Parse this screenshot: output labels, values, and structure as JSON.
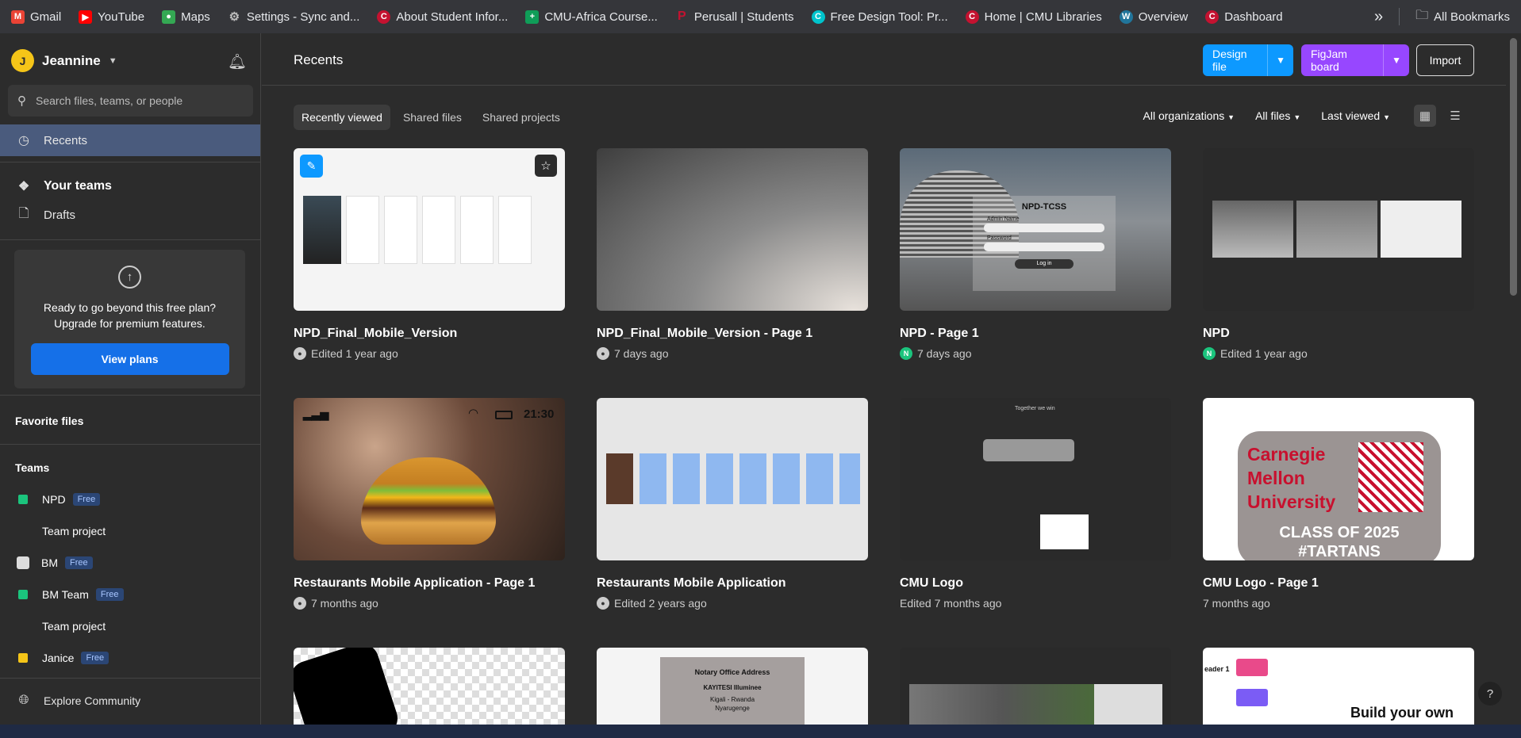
{
  "bookmarks": {
    "items": [
      {
        "label": "Gmail",
        "icon": "gmail-icon",
        "color": "#ea4335"
      },
      {
        "label": "YouTube",
        "icon": "youtube-icon",
        "color": "#ff0000"
      },
      {
        "label": "Maps",
        "icon": "maps-icon",
        "color": "#34a853"
      },
      {
        "label": "Settings - Sync and...",
        "icon": "settings-gear-icon",
        "color": "#9aa0a6"
      },
      {
        "label": "About Student Infor...",
        "icon": "cmu-icon",
        "color": "#c41230"
      },
      {
        "label": "CMU-Africa Course...",
        "icon": "sheets-icon",
        "color": "#0f9d58"
      },
      {
        "label": "Perusall | Students",
        "icon": "perusall-icon",
        "color": "#c41230"
      },
      {
        "label": "Free Design Tool: Pr...",
        "icon": "canva-icon",
        "color": "#00c4cc"
      },
      {
        "label": "Home | CMU Libraries",
        "icon": "cmu-icon",
        "color": "#c41230"
      },
      {
        "label": "Overview",
        "icon": "wordpress-icon",
        "color": "#21759b"
      },
      {
        "label": "Dashboard",
        "icon": "cmu-icon",
        "color": "#c41230"
      }
    ],
    "overflow_glyph": "»",
    "all_bookmarks": "All Bookmarks"
  },
  "sidebar": {
    "user": {
      "initial": "J",
      "name": "Jeannine"
    },
    "search_placeholder": "Search files, teams, or people",
    "nav": {
      "recents": "Recents",
      "your_teams": "Your teams",
      "drafts": "Drafts"
    },
    "upgrade": {
      "line1": "Ready to go beyond this free plan?",
      "line2": "Upgrade for premium features.",
      "button": "View plans"
    },
    "favorite_files": "Favorite files",
    "teams_title": "Teams",
    "teams": [
      {
        "name": "NPD",
        "badge": "Free",
        "color": "#1bc47d"
      },
      {
        "name": "Team project",
        "badge": "",
        "color": ""
      },
      {
        "name": "BM",
        "badge": "Free",
        "color": "avatar"
      },
      {
        "name": "BM Team",
        "badge": "Free",
        "color": "#1bc47d"
      },
      {
        "name": "Team project",
        "badge": "",
        "color": ""
      },
      {
        "name": "Janice",
        "badge": "Free",
        "color": "#f5c518"
      }
    ],
    "explore": "Explore Community"
  },
  "header": {
    "title": "Recents",
    "design_file": "Design file",
    "figjam_board": "FigJam board",
    "import": "Import"
  },
  "tabs": [
    "Recently viewed",
    "Shared files",
    "Shared projects"
  ],
  "filters": {
    "org": "All organizations",
    "files": "All files",
    "sort": "Last viewed"
  },
  "files": [
    {
      "name": "NPD_Final_Mobile_Version",
      "meta": "Edited 1 year ago",
      "avatar": "globe"
    },
    {
      "name": "NPD_Final_Mobile_Version - Page 1",
      "meta": "7 days ago",
      "avatar": "globe"
    },
    {
      "name": "NPD - Page 1",
      "meta": "7 days ago",
      "avatar": "N"
    },
    {
      "name": "NPD",
      "meta": "Edited 1 year ago",
      "avatar": "N"
    },
    {
      "name": "Restaurants Mobile Application - Page 1",
      "meta": "7 months ago",
      "avatar": "globe"
    },
    {
      "name": "Restaurants Mobile Application",
      "meta": "Edited 2 years ago",
      "avatar": "globe"
    },
    {
      "name": "CMU Logo",
      "meta": "Edited 7 months ago",
      "avatar": ""
    },
    {
      "name": "CMU Logo - Page 1",
      "meta": "7 months ago",
      "avatar": ""
    }
  ],
  "thumb_text": {
    "npd_tcss": "NPD-TCSS",
    "admin_name": "Admin Name",
    "password": "Password",
    "login": "Log in",
    "status_time": "21:30",
    "together": "Together we win",
    "cmu_words": [
      "Carnegie",
      "Mellon",
      "University"
    ],
    "class_of": "CLASS OF 2025",
    "tartans": "#TARTANS",
    "notary_title": "Notary Office Address",
    "notary_name": "KAYITESI Illuminee",
    "notary_city": "Kigali - Rwanda",
    "notary_district": "Nyarugenge",
    "build_own": "Build your own",
    "leader": "eader 1"
  },
  "help": "?"
}
